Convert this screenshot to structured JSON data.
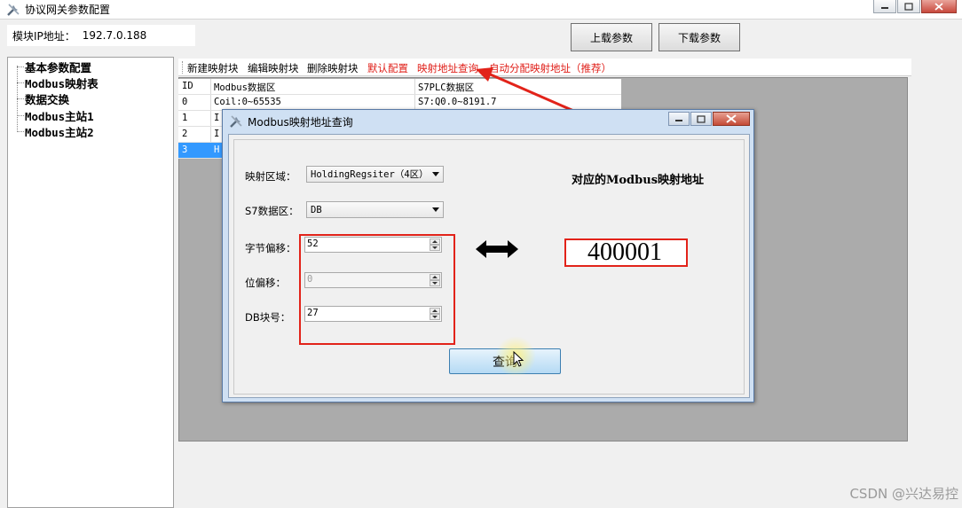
{
  "window": {
    "title": "协议网关参数配置"
  },
  "ip_bar": {
    "label": "模块IP地址：",
    "value": "192.7.0.188"
  },
  "buttons": {
    "upload": "上载参数",
    "download": "下载参数"
  },
  "tree": {
    "items": [
      "基本参数配置",
      "Modbus映射表",
      "数据交换",
      "Modbus主站1",
      "Modbus主站2"
    ]
  },
  "toolbar": {
    "items": [
      "新建映射块",
      "编辑映射块",
      "删除映射块",
      "默认配置",
      "映射地址查询",
      "自动分配映射地址（推荐）"
    ]
  },
  "grid": {
    "headers": [
      "ID",
      "Modbus数据区",
      "S7PLC数据区"
    ],
    "rows": [
      {
        "id": "0",
        "modbus": "Coil:0~65535",
        "s7": "S7:Q0.0~8191.7"
      },
      {
        "id": "1",
        "modbus": "I",
        "s7": ""
      },
      {
        "id": "2",
        "modbus": "I",
        "s7": ""
      },
      {
        "id": "3",
        "modbus": "H",
        "s7": ""
      }
    ],
    "selected_row": 3
  },
  "dialog": {
    "title": "Modbus映射地址查询",
    "fields": {
      "area_label": "映射区域：",
      "area_value": "HoldingRegsiter（4区）",
      "s7_label": "S7数据区：",
      "s7_value": "DB",
      "byte_offset_label": "字节偏移：",
      "byte_offset_value": "52",
      "bit_offset_label": "位偏移：",
      "bit_offset_value": "0",
      "db_label": "DB块号：",
      "db_value": "27"
    },
    "result_title": "对应的Modbus映射地址",
    "result_value": "400001",
    "query_button": "查询"
  },
  "colors": {
    "annotation_red": "#e2231a",
    "toolbar_red": "#e0201a",
    "selection_blue": "#3399ff",
    "grid_gray": "#ababab"
  },
  "watermark": "CSDN @兴达易控"
}
